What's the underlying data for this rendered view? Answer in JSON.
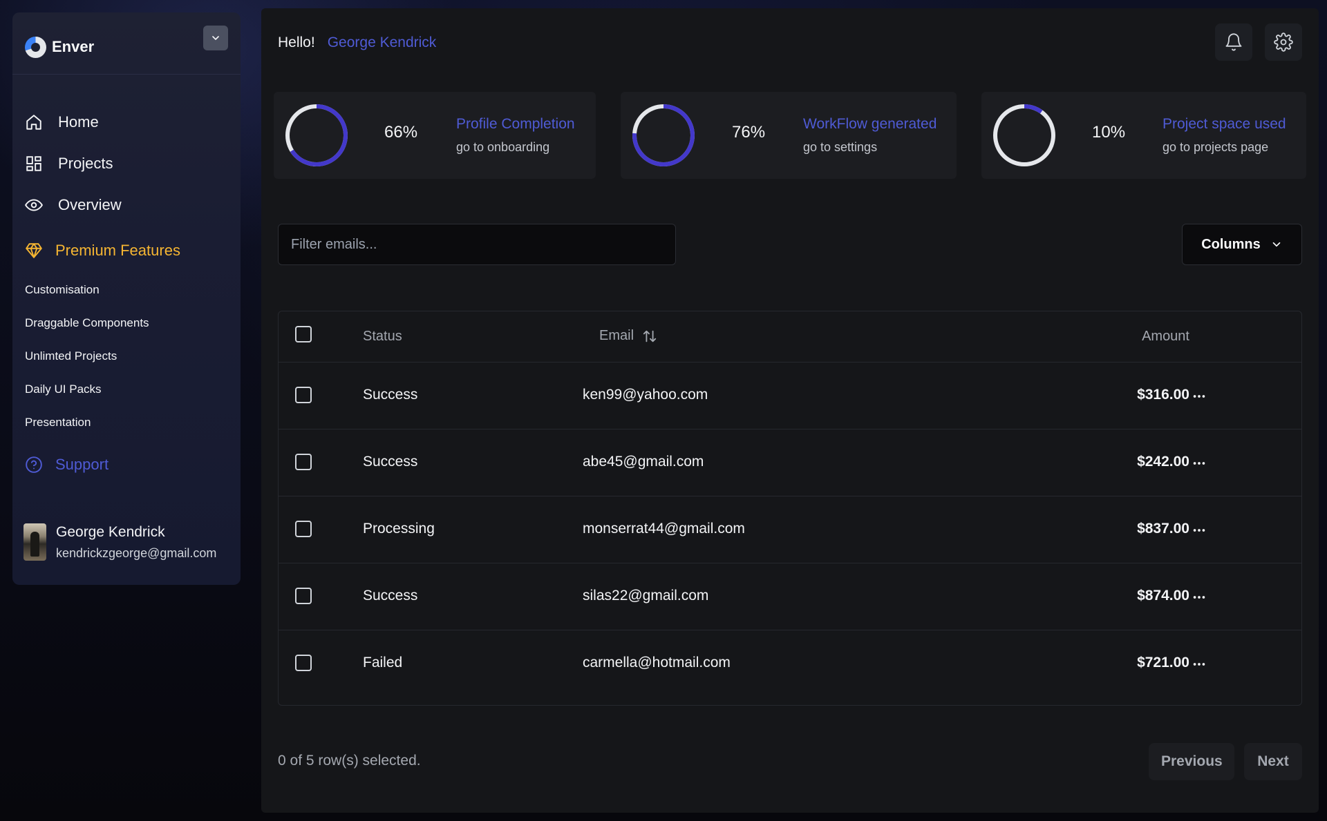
{
  "sidebar": {
    "brand_name": "Enver",
    "nav": [
      {
        "label": "Home",
        "icon": "home-icon"
      },
      {
        "label": "Projects",
        "icon": "grid-icon"
      },
      {
        "label": "Overview",
        "icon": "eye-icon"
      }
    ],
    "premium_label": "Premium Features",
    "premium_items": [
      "Customisation",
      "Draggable Components",
      "Unlimted Projects",
      "Daily UI Packs",
      "Presentation"
    ],
    "support_label": "Support",
    "user": {
      "name": "George Kendrick",
      "email": "kendrickzgeorge@gmail.com"
    }
  },
  "header": {
    "greeting": "Hello!",
    "user_name": "George Kendrick"
  },
  "stats": [
    {
      "percent_label": "66%",
      "value": 0.66,
      "title": "Profile Completion",
      "subtitle": "go to onboarding"
    },
    {
      "percent_label": "76%",
      "value": 0.76,
      "title": "WorkFlow generated",
      "subtitle": "go to settings"
    },
    {
      "percent_label": "10%",
      "value": 0.1,
      "title": "Project space used",
      "subtitle": "go to projects page"
    }
  ],
  "filter": {
    "placeholder": "Filter emails..."
  },
  "columns_label": "Columns",
  "table": {
    "headers": {
      "status": "Status",
      "email": "Email",
      "amount": "Amount"
    },
    "rows": [
      {
        "status": "Success",
        "email": "ken99@yahoo.com",
        "amount": "$316.00"
      },
      {
        "status": "Success",
        "email": "abe45@gmail.com",
        "amount": "$242.00"
      },
      {
        "status": "Processing",
        "email": "monserrat44@gmail.com",
        "amount": "$837.00"
      },
      {
        "status": "Success",
        "email": "silas22@gmail.com",
        "amount": "$874.00"
      },
      {
        "status": "Failed",
        "email": "carmella@hotmail.com",
        "amount": "$721.00"
      }
    ]
  },
  "footer": {
    "selected_text": "0 of 5 row(s) selected.",
    "previous_label": "Previous",
    "next_label": "Next"
  },
  "colors": {
    "accent": "#4f5bd5",
    "premium": "#f5b532",
    "ring_track": "#e5e7eb",
    "ring_fill": "#4338ca"
  }
}
